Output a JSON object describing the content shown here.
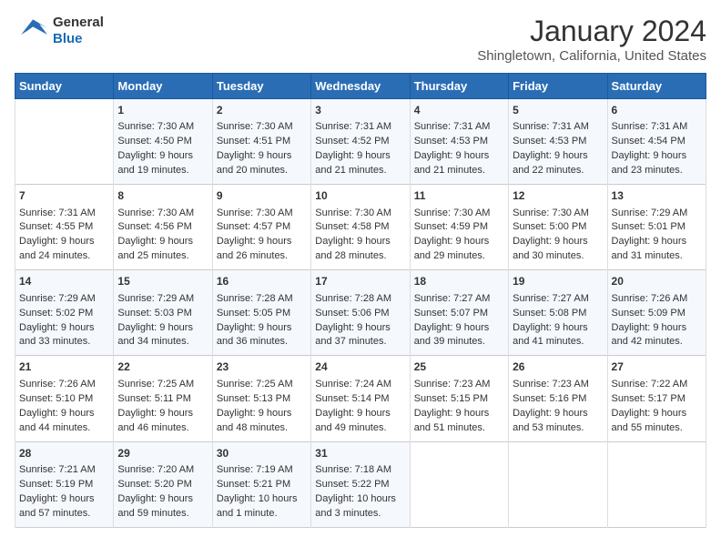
{
  "header": {
    "logo_line1": "General",
    "logo_line2": "Blue",
    "month": "January 2024",
    "location": "Shingletown, California, United States"
  },
  "days_of_week": [
    "Sunday",
    "Monday",
    "Tuesday",
    "Wednesday",
    "Thursday",
    "Friday",
    "Saturday"
  ],
  "weeks": [
    [
      {
        "day": "",
        "info": ""
      },
      {
        "day": "1",
        "info": "Sunrise: 7:30 AM\nSunset: 4:50 PM\nDaylight: 9 hours\nand 19 minutes."
      },
      {
        "day": "2",
        "info": "Sunrise: 7:30 AM\nSunset: 4:51 PM\nDaylight: 9 hours\nand 20 minutes."
      },
      {
        "day": "3",
        "info": "Sunrise: 7:31 AM\nSunset: 4:52 PM\nDaylight: 9 hours\nand 21 minutes."
      },
      {
        "day": "4",
        "info": "Sunrise: 7:31 AM\nSunset: 4:53 PM\nDaylight: 9 hours\nand 21 minutes."
      },
      {
        "day": "5",
        "info": "Sunrise: 7:31 AM\nSunset: 4:53 PM\nDaylight: 9 hours\nand 22 minutes."
      },
      {
        "day": "6",
        "info": "Sunrise: 7:31 AM\nSunset: 4:54 PM\nDaylight: 9 hours\nand 23 minutes."
      }
    ],
    [
      {
        "day": "7",
        "info": "Sunrise: 7:31 AM\nSunset: 4:55 PM\nDaylight: 9 hours\nand 24 minutes."
      },
      {
        "day": "8",
        "info": "Sunrise: 7:30 AM\nSunset: 4:56 PM\nDaylight: 9 hours\nand 25 minutes."
      },
      {
        "day": "9",
        "info": "Sunrise: 7:30 AM\nSunset: 4:57 PM\nDaylight: 9 hours\nand 26 minutes."
      },
      {
        "day": "10",
        "info": "Sunrise: 7:30 AM\nSunset: 4:58 PM\nDaylight: 9 hours\nand 28 minutes."
      },
      {
        "day": "11",
        "info": "Sunrise: 7:30 AM\nSunset: 4:59 PM\nDaylight: 9 hours\nand 29 minutes."
      },
      {
        "day": "12",
        "info": "Sunrise: 7:30 AM\nSunset: 5:00 PM\nDaylight: 9 hours\nand 30 minutes."
      },
      {
        "day": "13",
        "info": "Sunrise: 7:29 AM\nSunset: 5:01 PM\nDaylight: 9 hours\nand 31 minutes."
      }
    ],
    [
      {
        "day": "14",
        "info": "Sunrise: 7:29 AM\nSunset: 5:02 PM\nDaylight: 9 hours\nand 33 minutes."
      },
      {
        "day": "15",
        "info": "Sunrise: 7:29 AM\nSunset: 5:03 PM\nDaylight: 9 hours\nand 34 minutes."
      },
      {
        "day": "16",
        "info": "Sunrise: 7:28 AM\nSunset: 5:05 PM\nDaylight: 9 hours\nand 36 minutes."
      },
      {
        "day": "17",
        "info": "Sunrise: 7:28 AM\nSunset: 5:06 PM\nDaylight: 9 hours\nand 37 minutes."
      },
      {
        "day": "18",
        "info": "Sunrise: 7:27 AM\nSunset: 5:07 PM\nDaylight: 9 hours\nand 39 minutes."
      },
      {
        "day": "19",
        "info": "Sunrise: 7:27 AM\nSunset: 5:08 PM\nDaylight: 9 hours\nand 41 minutes."
      },
      {
        "day": "20",
        "info": "Sunrise: 7:26 AM\nSunset: 5:09 PM\nDaylight: 9 hours\nand 42 minutes."
      }
    ],
    [
      {
        "day": "21",
        "info": "Sunrise: 7:26 AM\nSunset: 5:10 PM\nDaylight: 9 hours\nand 44 minutes."
      },
      {
        "day": "22",
        "info": "Sunrise: 7:25 AM\nSunset: 5:11 PM\nDaylight: 9 hours\nand 46 minutes."
      },
      {
        "day": "23",
        "info": "Sunrise: 7:25 AM\nSunset: 5:13 PM\nDaylight: 9 hours\nand 48 minutes."
      },
      {
        "day": "24",
        "info": "Sunrise: 7:24 AM\nSunset: 5:14 PM\nDaylight: 9 hours\nand 49 minutes."
      },
      {
        "day": "25",
        "info": "Sunrise: 7:23 AM\nSunset: 5:15 PM\nDaylight: 9 hours\nand 51 minutes."
      },
      {
        "day": "26",
        "info": "Sunrise: 7:23 AM\nSunset: 5:16 PM\nDaylight: 9 hours\nand 53 minutes."
      },
      {
        "day": "27",
        "info": "Sunrise: 7:22 AM\nSunset: 5:17 PM\nDaylight: 9 hours\nand 55 minutes."
      }
    ],
    [
      {
        "day": "28",
        "info": "Sunrise: 7:21 AM\nSunset: 5:19 PM\nDaylight: 9 hours\nand 57 minutes."
      },
      {
        "day": "29",
        "info": "Sunrise: 7:20 AM\nSunset: 5:20 PM\nDaylight: 9 hours\nand 59 minutes."
      },
      {
        "day": "30",
        "info": "Sunrise: 7:19 AM\nSunset: 5:21 PM\nDaylight: 10 hours\nand 1 minute."
      },
      {
        "day": "31",
        "info": "Sunrise: 7:18 AM\nSunset: 5:22 PM\nDaylight: 10 hours\nand 3 minutes."
      },
      {
        "day": "",
        "info": ""
      },
      {
        "day": "",
        "info": ""
      },
      {
        "day": "",
        "info": ""
      }
    ]
  ]
}
